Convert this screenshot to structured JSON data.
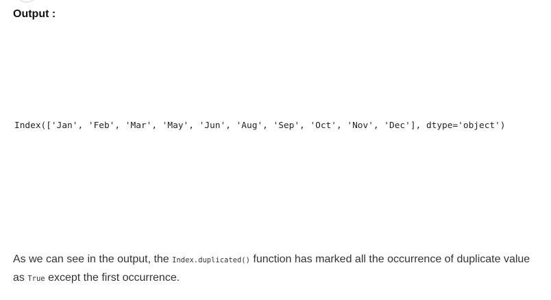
{
  "heading": "Output :",
  "code_output": "Index(['Jan', 'Feb', 'Mar', 'May', 'Jun', 'Aug', 'Sep', 'Oct', 'Nov', 'Dec'], dtype='object')",
  "explanation": {
    "part1": "As we can see in the output, the ",
    "code1": "Index.duplicated()",
    "part2": " function has marked all the occurrence of duplicate value as ",
    "code2": "True",
    "part3": " except the first occurrence."
  }
}
